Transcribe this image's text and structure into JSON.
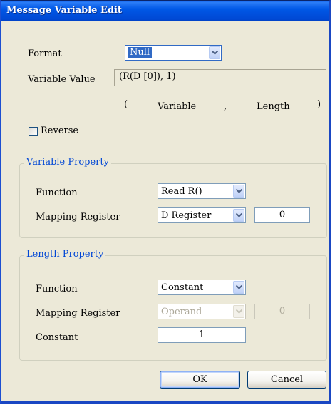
{
  "window": {
    "title": "Message Variable Edit"
  },
  "format": {
    "label": "Format",
    "value": "Null"
  },
  "variable_value": {
    "label": "Variable Value",
    "value": "(R(D [0]), 1)",
    "hint_open": "(",
    "hint_variable": "Variable",
    "hint_sep": ",",
    "hint_length": "Length",
    "hint_close": ")"
  },
  "reverse": {
    "label": "Reverse",
    "checked": false
  },
  "variable_property": {
    "legend": "Variable Property",
    "function_label": "Function",
    "function_value": "Read R()",
    "mapping_label": "Mapping Register",
    "mapping_value": "D Register",
    "mapping_number": "0"
  },
  "length_property": {
    "legend": "Length Property",
    "function_label": "Function",
    "function_value": "Constant",
    "mapping_label": "Mapping Register",
    "mapping_value": "Operand",
    "mapping_number": "0",
    "constant_label": "Constant",
    "constant_value": "1"
  },
  "buttons": {
    "ok": "OK",
    "cancel": "Cancel"
  }
}
